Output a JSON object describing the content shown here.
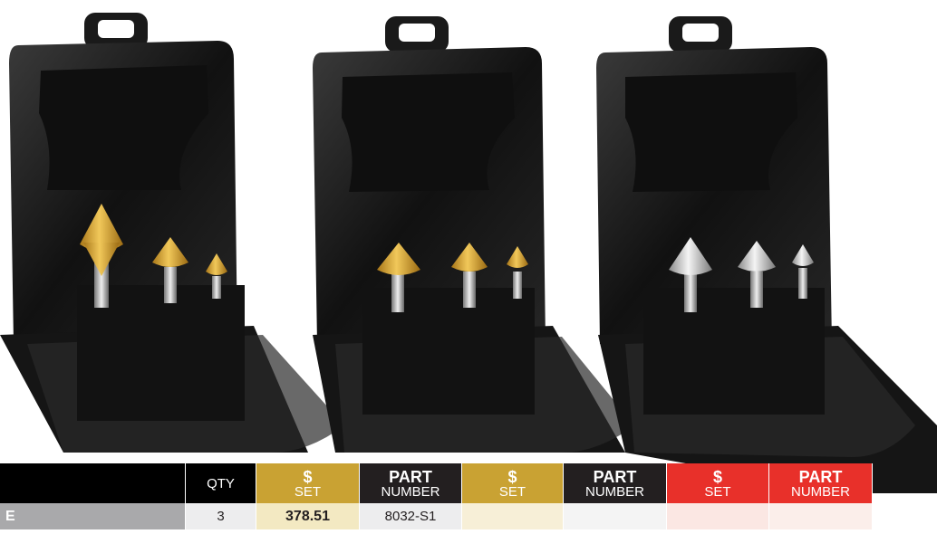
{
  "photo": {
    "cases": [
      {
        "name": "case-tin-coated",
        "bit_color": "#d9a02c"
      },
      {
        "name": "case-tin-coated-2",
        "bit_color": "#d8a634"
      },
      {
        "name": "case-uncoated",
        "bit_color": "#cfcfcf"
      }
    ]
  },
  "table": {
    "header": {
      "qty": "QTY",
      "set_symbol": "$",
      "set_label": "SET",
      "part_top": "PART",
      "part_bottom": "NUMBER"
    },
    "rows": [
      {
        "label": "E",
        "qty": "3",
        "set1": "378.51",
        "part1": "8032-S1",
        "set2": "",
        "part2": "",
        "set3": "",
        "part3": ""
      }
    ]
  },
  "colors": {
    "gold": "#c9a233",
    "dark": "#231f20",
    "red": "#e8302a"
  }
}
